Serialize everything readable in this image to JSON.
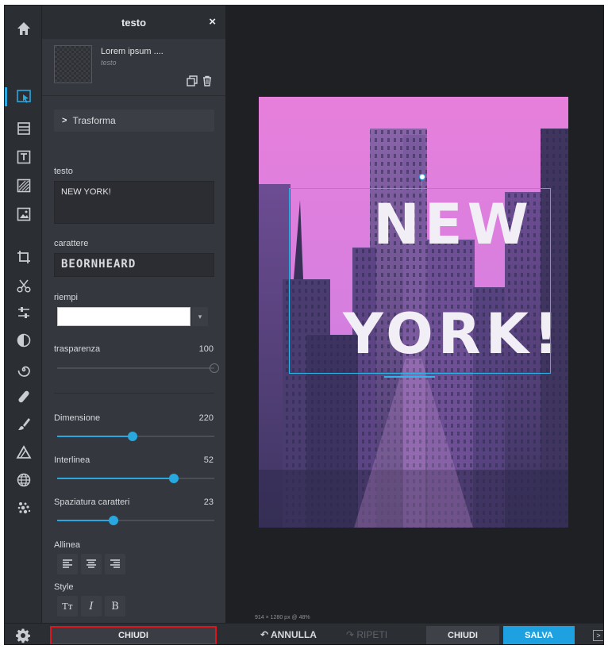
{
  "panel": {
    "title": "testo",
    "close_icon": "×",
    "layer": {
      "name": "Lorem ipsum ....",
      "type": "testo"
    },
    "trasforma_label": "Trasforma",
    "text_label": "testo",
    "text_value": "NEW YORK!",
    "font_label": "carattere",
    "font_value": "BEORNHEARD",
    "fill_label": "riempi",
    "fill_color": "#ffffff",
    "transparency": {
      "label": "trasparenza",
      "value": "100",
      "level_percent": 100
    },
    "size": {
      "label": "Dimensione",
      "value": "220",
      "level_percent": 48
    },
    "line_height": {
      "label": "Interlinea",
      "value": "52",
      "level_percent": 74
    },
    "letter_spacing": {
      "label": "Spaziatura caratteri",
      "value": "23",
      "level_percent": 36
    },
    "align_label": "Allinea",
    "style_label": "Style",
    "style_buttons": [
      "Tт",
      "I",
      "B"
    ]
  },
  "bottombar": {
    "close_left": "CHIUDI",
    "undo": "ANNULLA",
    "redo": "RIPETI",
    "close_right": "CHIUDI",
    "save": "SALVA"
  },
  "workspace": {
    "canvas_info": "914 × 1280 px @ 48%",
    "poster_line1": "NEW",
    "poster_line2": "YORK!"
  },
  "colors": {
    "accent": "#29a8e0",
    "save_button": "#1ea1e1",
    "highlight_border": "#e0141c",
    "panel_bg": "#34373d",
    "workspace_bg": "#1e2024"
  }
}
